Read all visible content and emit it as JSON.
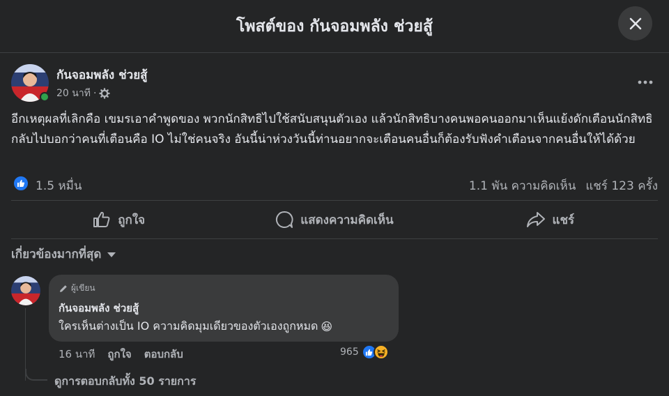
{
  "dialog": {
    "title": "โพสต์ของ กันจอมพลัง ช่วยสู้"
  },
  "post": {
    "author": "กันจอมพลัง ช่วยสู้",
    "time": "20 นาที",
    "separator": "·",
    "body": "อีกเหตุผลที่เลิกคือ เขมรเอาคำพูดของ พวกนักสิทธิไปใช้สนับสนุนตัวเอง แล้วนักสิทธิบางคนพอคนออกมาเห็นแย้งดักเตือนนักสิทธิกลับไปบอกว่าคนที่เตือนคือ IO ไม่ใช่คนจริง อันนี้น่าห่วงวันนี้ท่านอยากจะเตือนคนอื่นก็ต้องรับฟังคำเตือนจากคนอื่นให้ได้ด้วย",
    "reactions": "1.5 หมื่น",
    "comments": "1.1 พัน ความคิดเห็น",
    "shares": "แชร์ 123 ครั้ง"
  },
  "actions": {
    "like": "ถูกใจ",
    "comment": "แสดงความคิดเห็น",
    "share": "แชร์"
  },
  "sort": {
    "label": "เกี่ยวข้องมากที่สุด"
  },
  "comment": {
    "badge": "ผู้เขียน",
    "author": "กันจอมพลัง ช่วยสู้",
    "text": "ใครเห็นต่างเป็น IO ความคิดมุมเดียวของตัวเองถูกหมด",
    "emoji": "😆",
    "time": "16 นาที",
    "like": "ถูกใจ",
    "reply": "ตอบกลับ",
    "reaction_count": "965"
  },
  "replies": {
    "label": "ดูการตอบกลับทั้ง 50 รายการ"
  },
  "icons": {
    "close": "close-icon",
    "more": "more-horizontal-icon",
    "privacy": "gear-icon",
    "like": "thumbs-up-icon",
    "comment": "comment-icon",
    "share": "share-icon",
    "sort": "caret-down-icon",
    "pencil": "pencil-icon"
  },
  "colors": {
    "background": "#242526",
    "bubble": "#3a3b3c",
    "like_blue": "#2078f4",
    "online": "#31a24c",
    "haha": "#f7b125"
  }
}
